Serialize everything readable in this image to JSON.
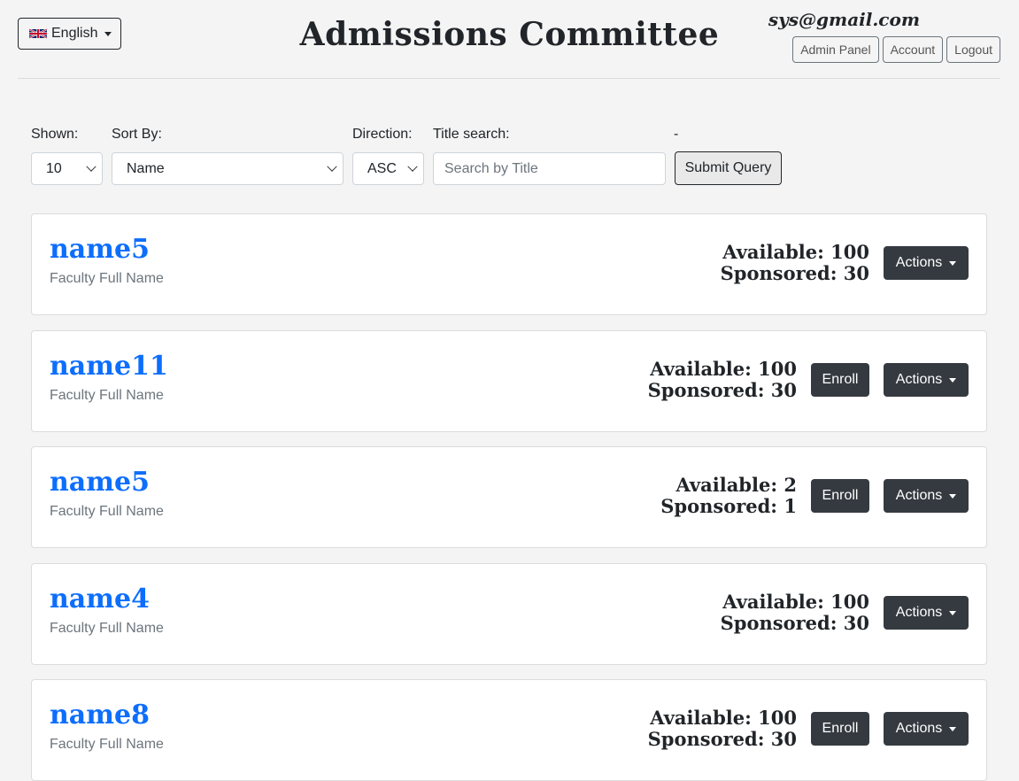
{
  "header": {
    "language": "English",
    "title": "Admissions Committee",
    "email": "sys@gmail.com",
    "buttons": [
      "Admin Panel",
      "Account",
      "Logout"
    ]
  },
  "filters": {
    "shown_label": "Shown:",
    "shown_value": "10",
    "sort_label": "Sort By:",
    "sort_value": "Name",
    "direction_label": "Direction:",
    "direction_value": "ASC",
    "title_label": "Title search:",
    "title_placeholder": "Search by Title",
    "dash": "-",
    "submit": "Submit Query"
  },
  "card_labels": {
    "available_prefix": "Available: ",
    "sponsored_prefix": "Sponsored: ",
    "enroll": "Enroll",
    "actions": "Actions"
  },
  "faculties": [
    {
      "name": "name5",
      "subtitle": "Faculty Full Name",
      "available": "Available: 100",
      "sponsored": "Sponsored: 30",
      "enroll": false
    },
    {
      "name": "name11",
      "subtitle": "Faculty Full Name",
      "available": "Available: 100",
      "sponsored": "Sponsored: 30",
      "enroll": true
    },
    {
      "name": "name5",
      "subtitle": "Faculty Full Name",
      "available": "Available: 2",
      "sponsored": "Sponsored: 1",
      "enroll": true
    },
    {
      "name": "name4",
      "subtitle": "Faculty Full Name",
      "available": "Available: 100",
      "sponsored": "Sponsored: 30",
      "enroll": false
    },
    {
      "name": "name8",
      "subtitle": "Faculty Full Name",
      "available": "Available: 100",
      "sponsored": "Sponsored: 30",
      "enroll": true
    }
  ]
}
